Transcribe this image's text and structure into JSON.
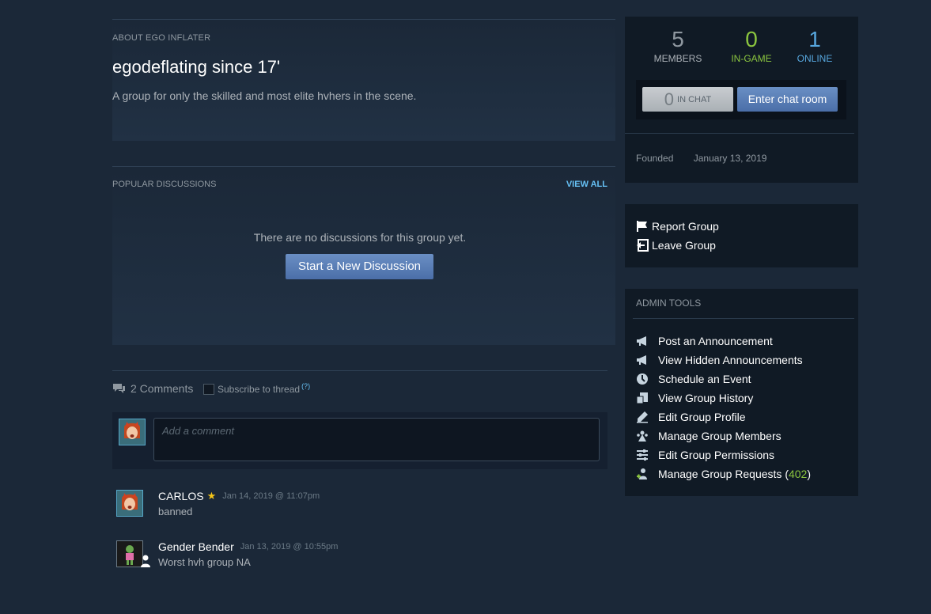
{
  "about": {
    "header": "ABOUT EGO INFLATER",
    "title": "egodeflating since 17'",
    "description": "A group for only the skilled and most elite hvhers in the scene."
  },
  "discussions": {
    "header": "POPULAR DISCUSSIONS",
    "view_all": "VIEW ALL",
    "empty_text": "There are no discussions for this group yet.",
    "start_button": "Start a New Discussion"
  },
  "comments": {
    "count_label": "2 Comments",
    "subscribe_label": "Subscribe to thread",
    "help": "(?)",
    "placeholder": "Add a comment",
    "items": [
      {
        "author": "CARLOS",
        "star": "★",
        "timestamp": "Jan 14, 2019 @ 11:07pm",
        "text": "banned"
      },
      {
        "author": "Gender Bender",
        "timestamp": "Jan 13, 2019 @ 10:55pm",
        "text": "Worst hvh group NA"
      }
    ]
  },
  "stats": {
    "members": {
      "value": "5",
      "label": "MEMBERS",
      "color": "#8f98a0"
    },
    "in_game": {
      "value": "0",
      "label": "IN-GAME",
      "color": "#8bc53f"
    },
    "online": {
      "value": "1",
      "label": "ONLINE",
      "color": "#57cbde"
    },
    "in_chat_value": "0",
    "in_chat_label": "IN CHAT",
    "enter_chat": "Enter chat room",
    "founded_label": "Founded",
    "founded_date": "January 13, 2019"
  },
  "actions": {
    "report": "Report Group",
    "leave": "Leave Group"
  },
  "admin": {
    "header": "ADMIN TOOLS",
    "items": {
      "post_announcement": "Post an Announcement",
      "view_hidden": "View Hidden Announcements",
      "schedule_event": "Schedule an Event",
      "view_history": "View Group History",
      "edit_profile": "Edit Group Profile",
      "manage_members": "Manage Group Members",
      "edit_permissions": "Edit Group Permissions",
      "manage_requests": "Manage Group Requests (",
      "requests_count": "402",
      "requests_close": ")"
    }
  },
  "icons": {
    "chat-bubble": "chat-bubble-icon",
    "flag": "flag-icon",
    "leave": "leave-icon",
    "megaphone": "megaphone-icon",
    "clock": "clock-icon",
    "history": "history-icon",
    "pencil": "pencil-icon",
    "members": "members-icon",
    "permissions": "sliders-icon",
    "requests": "user-plus-icon"
  }
}
